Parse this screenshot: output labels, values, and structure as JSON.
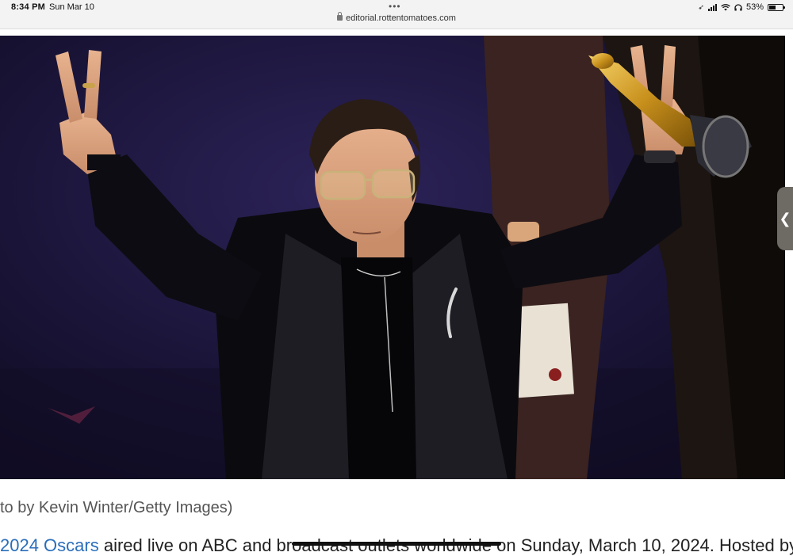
{
  "status_bar": {
    "time": "8:34 PM",
    "date": "Sun Mar 10",
    "url": "editorial.rottentomatoes.com",
    "battery_percent_text": "53%",
    "battery_level": 0.53,
    "multitask_dots": "•••"
  },
  "hero_image": {
    "alt": "Man in black suit with glasses raising peace signs and holding an Oscar statuette on stage"
  },
  "side_handle": {
    "glyph": "❮"
  },
  "caption": {
    "text": "to by Kevin Winter/Getty Images)"
  },
  "article": {
    "link_text": "2024 Oscars",
    "text_after_link": " aired live on ABC and broadcast outlets worldwide on Sunday, March 10, 2024. Hosted by"
  },
  "colors": {
    "link": "#2a6ebb",
    "status_bar_bg": "#f3f3f4",
    "photo_background": "#14102a"
  }
}
